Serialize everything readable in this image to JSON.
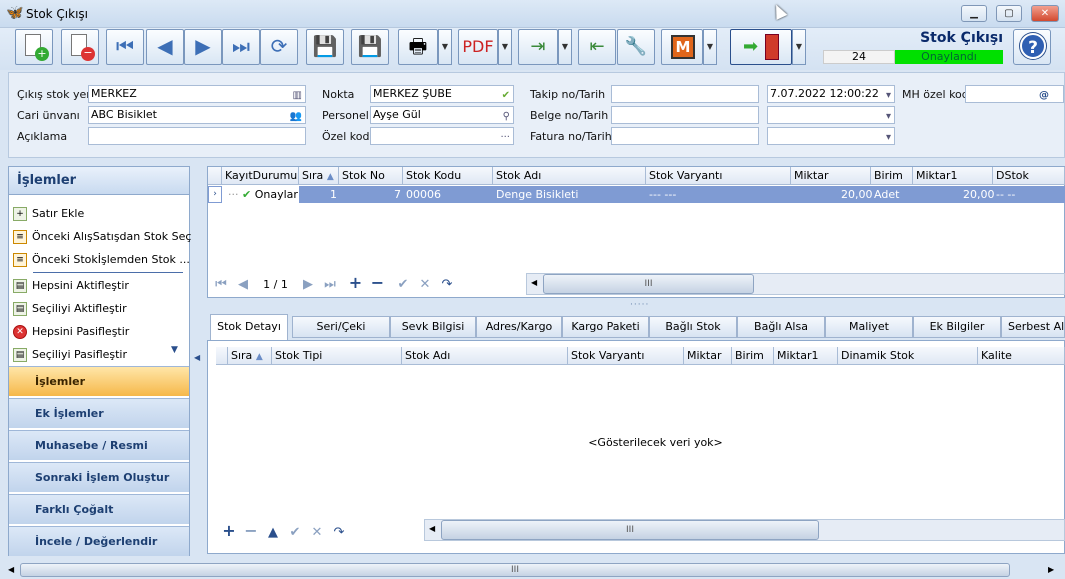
{
  "window": {
    "title": "Stok Çıkışı",
    "btn_min": "▁",
    "btn_max": "▢",
    "btn_close": "✕"
  },
  "toolbar": {
    "buttons": [
      "new",
      "delete",
      "first",
      "prev",
      "next",
      "last",
      "refresh",
      "save",
      "save-close",
      "print",
      "pdf",
      "export",
      "import",
      "tools",
      "m-app",
      "exit"
    ],
    "m_label": "M",
    "record_number": "24",
    "status": "Onaylandı",
    "heading": "Stok Çıkışı",
    "help": "?"
  },
  "header": {
    "cikis_stok_yeri_label": "Çıkış stok yeri",
    "cikis_stok_yeri": "MERKEZ",
    "cari_unvani_label": "Cari ünvanı",
    "cari_unvani": "ABC Bisiklet",
    "aciklama_label": "Açıklama",
    "aciklama": "",
    "nokta_label": "Nokta",
    "nokta": "MERKEZ ŞUBE",
    "personel_label": "Personel",
    "personel": "Ayşe Gül",
    "ozel_kod_label": "Özel kod",
    "ozel_kod": "",
    "takip_label": "Takip no/Tarih",
    "takip": "",
    "takip_tarih": "7.07.2022 12:00:22",
    "belge_label": "Belge no/Tarih",
    "belge": "",
    "fatura_label": "Fatura no/Tarih",
    "fatura": "",
    "mh_label": "MH özel kod",
    "mh": ""
  },
  "left": {
    "title": "İşlemler",
    "items": [
      "Satır Ekle",
      "Önceki AlışSatışdan Stok Seç",
      "Önceki Stokİşlemden Stok ...",
      "Hepsini Aktifleştir",
      "Seçiliyi Aktifleştir",
      "Hepsini Pasifleştir",
      "Seçiliyi Pasifleştir"
    ],
    "nav": [
      "İşlemler",
      "Ek İşlemler",
      "Muhasebe / Resmi İşlemler",
      "Sonraki İşlem Oluştur",
      "Farklı Çoğalt",
      "İncele / Değerlendir"
    ]
  },
  "grid": {
    "columns": [
      "KayıtDurumu",
      "Sıra",
      "Stok No",
      "Stok Kodu",
      "Stok Adı",
      "Stok Varyantı",
      "Miktar",
      "Birim",
      "Miktar1",
      "DStok"
    ],
    "row": {
      "durum": "Onaylar",
      "sira": "1",
      "stok_no": "7",
      "stok_kodu": "00006",
      "stok_adi": "Denge Bisikleti",
      "varyant": "--- ---",
      "miktar": "20,00",
      "birim": "Adet",
      "miktar1": "20,00",
      "dstok": "-- --"
    },
    "pager": "1 / 1",
    "scroll_grip": "III"
  },
  "tabs": [
    "Stok Detayı",
    "Seri/Çeki",
    "Sevk Bilgisi",
    "Adres/Kargo",
    "Kargo Paketi",
    "Bağlı Stok",
    "Bağlı Alsa",
    "Maliyet",
    "Ek Bilgiler",
    "Serbest Al"
  ],
  "detail": {
    "columns": [
      "Sıra",
      "Stok Tipi",
      "Stok Adı",
      "Stok Varyantı",
      "Miktar",
      "Birim",
      "Miktar1",
      "Dinamik Stok",
      "Kalite"
    ],
    "empty": "<Gösterilecek veri yok>",
    "scroll_grip": "III"
  },
  "bottom": {
    "scroll_grip": "III"
  }
}
